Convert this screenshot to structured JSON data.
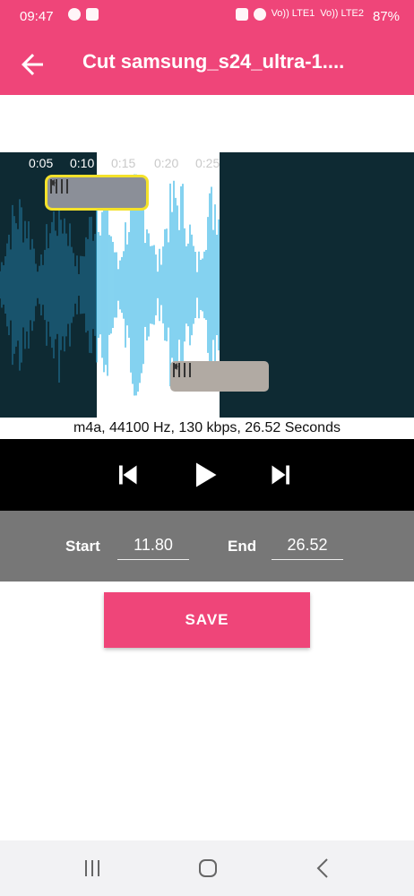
{
  "status": {
    "time": "09:47",
    "battery": "87%",
    "net1": "Vo)) LTE1",
    "net2": "Vo)) LTE2"
  },
  "appbar": {
    "title": "Cut samsung_s24_ultra-1...."
  },
  "waveform": {
    "ticks": [
      "0:05",
      "0:10",
      "0:15",
      "0:20",
      "0:25"
    ],
    "selection_start_seconds": 11.8,
    "selection_end_seconds": 26.52
  },
  "file_info": "m4a, 44100 Hz, 130 kbps, 26.52 Seconds",
  "range": {
    "start_label": "Start",
    "start_value": "11.80",
    "end_label": "End",
    "end_value": "26.52"
  },
  "save_label": "SAVE",
  "colors": {
    "accent": "#ef4579",
    "wave": "#33b5e5",
    "wave_dark": "#0e2a33"
  }
}
